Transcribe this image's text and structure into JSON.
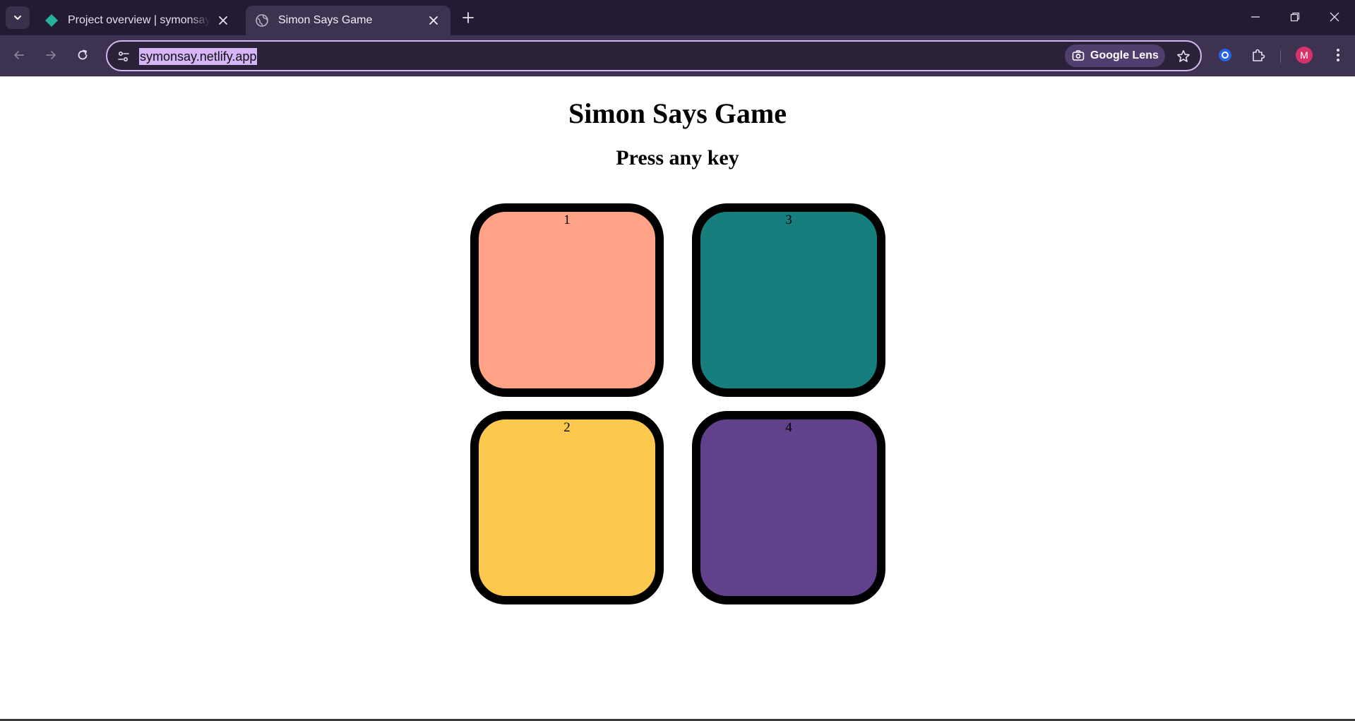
{
  "browser": {
    "tabs": [
      {
        "title": "Project overview | symonsay | N",
        "active": false,
        "favicon": "netlify-diamond-icon"
      },
      {
        "title": "Simon Says Game",
        "active": true,
        "favicon": "globe-icon"
      }
    ],
    "address_bar": {
      "url": "symonsay.netlify.app",
      "lens_label": "Google Lens"
    },
    "profile_initial": "M",
    "colors": {
      "titlebar": "#231a33",
      "toolbar": "#3d3350",
      "omnibox_border": "#d7b8f2",
      "url_highlight": "#d4b5f7",
      "avatar": "#d6336c",
      "netlify_teal": "#25b0a0"
    }
  },
  "page": {
    "title": "Simon Says Game",
    "subtitle": "Press any key",
    "buttons": [
      {
        "label": "1",
        "color": "#ffa286"
      },
      {
        "label": "2",
        "color": "#fdc84e"
      },
      {
        "label": "3",
        "color": "#177e7e"
      },
      {
        "label": "4",
        "color": "#62418c"
      }
    ]
  }
}
